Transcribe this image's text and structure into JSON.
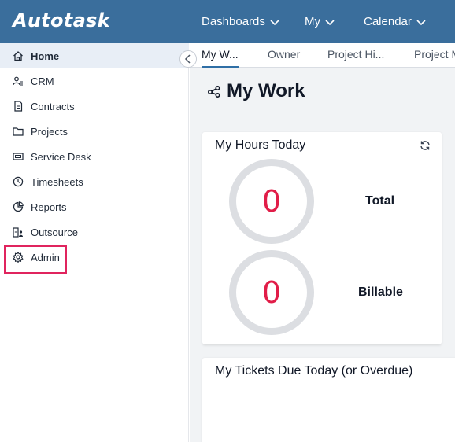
{
  "app": {
    "logo": "Autotask"
  },
  "topnav": {
    "dashboards": "Dashboards",
    "my": "My",
    "calendar": "Calendar"
  },
  "sidebar": {
    "items": [
      {
        "label": "Home",
        "icon": "home-icon"
      },
      {
        "label": "CRM",
        "icon": "users-icon"
      },
      {
        "label": "Contracts",
        "icon": "contract-icon"
      },
      {
        "label": "Projects",
        "icon": "folder-icon"
      },
      {
        "label": "Service Desk",
        "icon": "service-desk-icon"
      },
      {
        "label": "Timesheets",
        "icon": "clock-icon"
      },
      {
        "label": "Reports",
        "icon": "report-icon"
      },
      {
        "label": "Outsource",
        "icon": "outsource-icon"
      },
      {
        "label": "Admin",
        "icon": "gear-icon"
      }
    ],
    "active_item": "Home",
    "highlighted_item": "Admin"
  },
  "tabs": [
    "My W...",
    "Owner",
    "Project Hi...",
    "Project M"
  ],
  "page": {
    "title": "My Work"
  },
  "hours_card": {
    "title": "My Hours Today",
    "total_value": "0",
    "total_label": "Total",
    "billable_value": "0",
    "billable_label": "Billable"
  },
  "tickets_card": {
    "title": "My Tickets Due Today (or Overdue)"
  },
  "colors": {
    "topbar": "#3a6e9c",
    "highlight": "#e0245e",
    "metric": "#e11d48"
  }
}
